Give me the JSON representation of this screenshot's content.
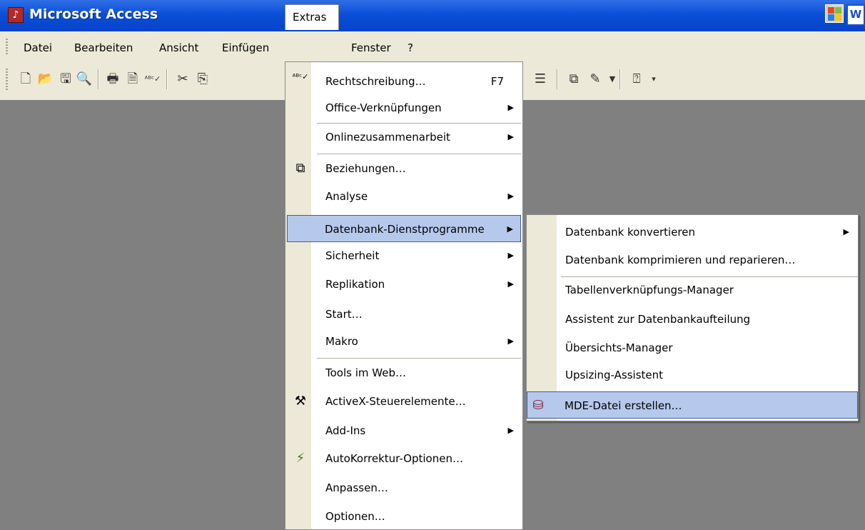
{
  "window": {
    "title": "Microsoft Access",
    "app_icon": "access-logo-icon",
    "right_icon": "word-logo-icon",
    "right_icon_text": "W"
  },
  "menubar": {
    "items": [
      "Datei",
      "Bearbeiten",
      "Ansicht",
      "Einfügen",
      "Extras",
      "Fenster",
      "?"
    ],
    "active": "Extras"
  },
  "toolbar": {
    "icons": [
      "new-icon",
      "open-icon",
      "save-icon",
      "file-search-icon",
      "print-icon",
      "print-preview-icon",
      "spelling-icon",
      "cut-icon",
      "copy-icon",
      "properties-icon",
      "relationships-icon",
      "new-object-icon",
      "help-icon"
    ]
  },
  "extras_menu": {
    "items": [
      {
        "label": "Rechtschreibung…",
        "shortcut": "F7",
        "icon": "spelling-icon"
      },
      {
        "label": "Office-Verknüpfungen",
        "submenu": true
      },
      {
        "label": "Onlinezusammenarbeit",
        "submenu": true
      },
      {
        "label": "Beziehungen…",
        "icon": "relationships-icon"
      },
      {
        "label": "Analyse",
        "submenu": true
      },
      {
        "label": "Datenbank-Dienstprogramme",
        "submenu": true,
        "highlighted": true
      },
      {
        "label": "Sicherheit",
        "submenu": true
      },
      {
        "label": "Replikation",
        "submenu": true
      },
      {
        "label": "Start…"
      },
      {
        "label": "Makro",
        "submenu": true
      },
      {
        "label": "Tools im Web…"
      },
      {
        "label": "ActiveX-Steuerelemente…",
        "icon": "activex-tools-icon"
      },
      {
        "label": "Add-Ins",
        "submenu": true
      },
      {
        "label": "AutoKorrektur-Optionen…",
        "icon": "autocorrect-icon"
      },
      {
        "label": "Anpassen…"
      },
      {
        "label": "Optionen…"
      }
    ]
  },
  "db_utilities_submenu": {
    "items": [
      {
        "label": "Datenbank konvertieren",
        "submenu": true
      },
      {
        "label": "Datenbank komprimieren und reparieren…"
      },
      {
        "label": "Tabellenverknüpfungs-Manager"
      },
      {
        "label": "Assistent zur Datenbankaufteilung"
      },
      {
        "label": "Übersichts-Manager"
      },
      {
        "label": "Upsizing-Assistent"
      },
      {
        "label": "MDE-Datei erstellen…",
        "icon": "mde-file-icon",
        "highlighted": true
      }
    ]
  },
  "colors": {
    "title_bar": "#0a4fd8",
    "menu_bg": "#ece9d8",
    "highlight": "#b6c8ec",
    "highlight_border": "#3a5ea8",
    "workspace": "#808080"
  }
}
